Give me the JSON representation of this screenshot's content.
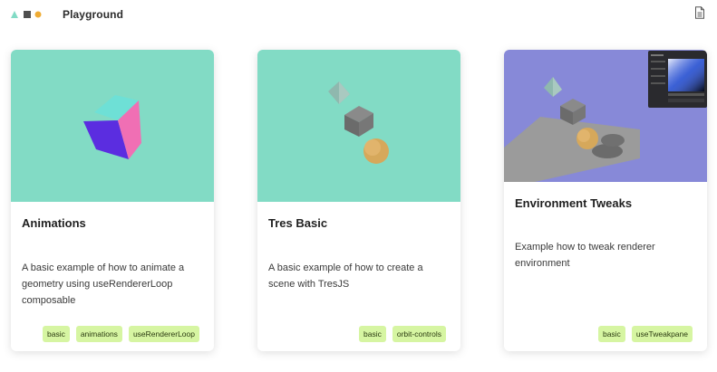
{
  "header": {
    "title": "Playground",
    "logo_colors": {
      "triangle": "#82dbc5",
      "square": "#4f4f4f",
      "circle": "#efac35"
    },
    "doc_icon": "document-icon"
  },
  "cards": [
    {
      "title": "Animations",
      "description": "A basic example of how to animate a geometry using useRendererLoop composable",
      "tags": [
        "basic",
        "animations",
        "useRendererLoop"
      ],
      "thumbnail_bg": "#82dbc5"
    },
    {
      "title": "Tres Basic",
      "description": "A basic example of how to create a scene with TresJS",
      "tags": [
        "basic",
        "orbit-controls"
      ],
      "thumbnail_bg": "#82dbc5"
    },
    {
      "title": "Environment Tweaks",
      "description": "Example how to tweak renderer environment",
      "tags": [
        "basic",
        "useTweakpane"
      ],
      "thumbnail_bg": "#8789d8"
    }
  ],
  "colors": {
    "tag_bg": "#d6f5a2",
    "tag_text": "#2a3a10"
  }
}
